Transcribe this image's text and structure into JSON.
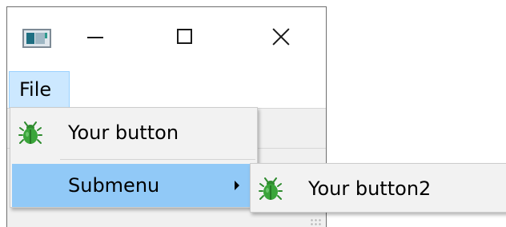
{
  "window": {
    "caption_buttons": [
      "minimize",
      "maximize",
      "close"
    ],
    "icon": "app-window-icon"
  },
  "menubar": {
    "items": [
      {
        "label": "File"
      }
    ]
  },
  "file_menu": {
    "items": [
      {
        "label": "Your button",
        "icon": "bug-icon"
      },
      {
        "label": "Submenu",
        "has_submenu": true
      }
    ]
  },
  "submenu": {
    "items": [
      {
        "label": "Your button2",
        "icon": "bug-icon"
      }
    ]
  },
  "colors": {
    "menubar_highlight": "#cce8ff",
    "menu_item_hover": "#91c9f7",
    "popup_background": "#f2f2f2",
    "bug_icon_green": "#2e8b2e"
  }
}
